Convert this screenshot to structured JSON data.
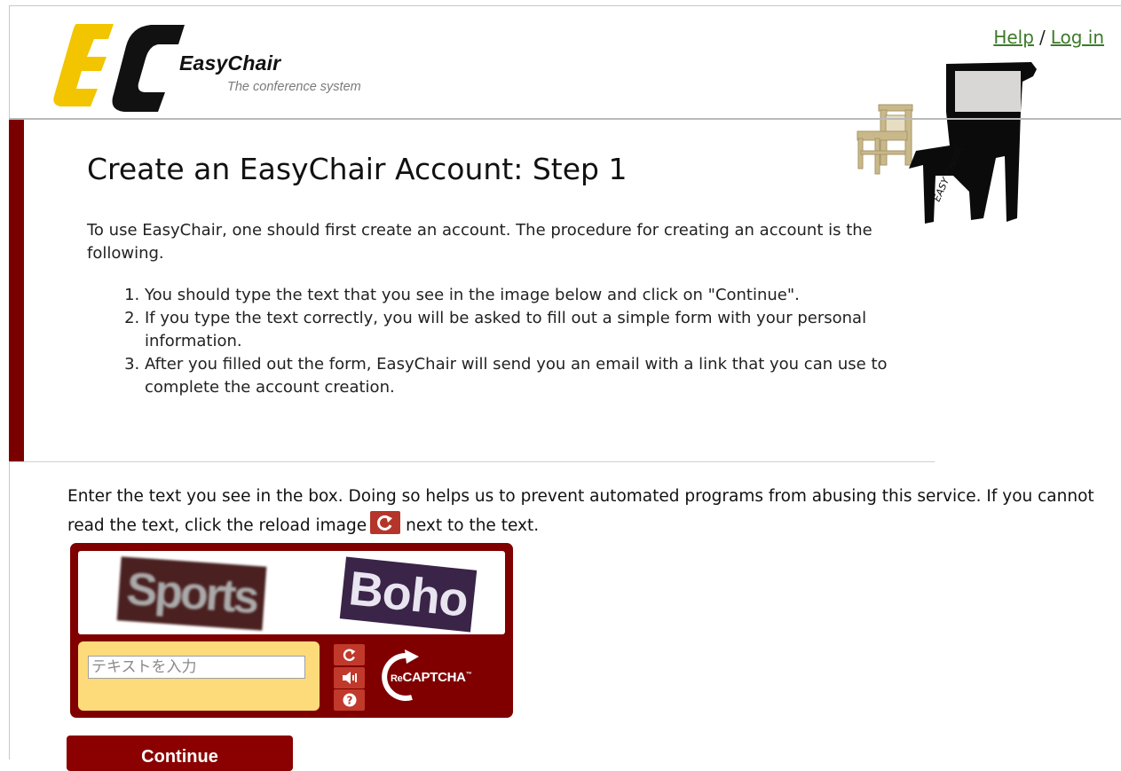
{
  "header": {
    "logo_title": "EasyChair",
    "logo_subtitle": "The conference system",
    "help_link": "Help",
    "separator": "/",
    "login_link": "Log in",
    "chair_caption": "EASY CHAIR"
  },
  "main": {
    "title": "Create an EasyChair Account: Step 1",
    "intro": "To use EasyChair, one should first create an account. The procedure for creating an account is the following.",
    "steps": [
      "You should type the text that you see in the image below and click on \"Continue\".",
      "If you type the text correctly, you will be asked to fill out a simple form with your personal information.",
      "After you filled out the form, EasyChair will send you an email with a link that you can use to complete the account creation."
    ]
  },
  "captcha": {
    "instructions_before": "Enter the text you see in the box. Doing so helps us to prevent automated programs from abusing this service. If you cannot read the text, click the reload image",
    "instructions_after": "next to the text.",
    "word1": "Sports",
    "word2": "Boho",
    "input_placeholder": "テキストを入力",
    "input_value": "",
    "logo_re": "Re",
    "logo_text": "CAPTCHA",
    "logo_tm": "™"
  },
  "actions": {
    "continue_label": "Continue"
  },
  "colors": {
    "brand_red": "#800000",
    "link_green": "#3d7a2a",
    "logo_yellow": "#f2c500",
    "captcha_input_bg": "#fddb7a"
  },
  "icons": [
    "reload-icon",
    "audio-icon",
    "help-icon",
    "recaptcha-logo-icon"
  ]
}
